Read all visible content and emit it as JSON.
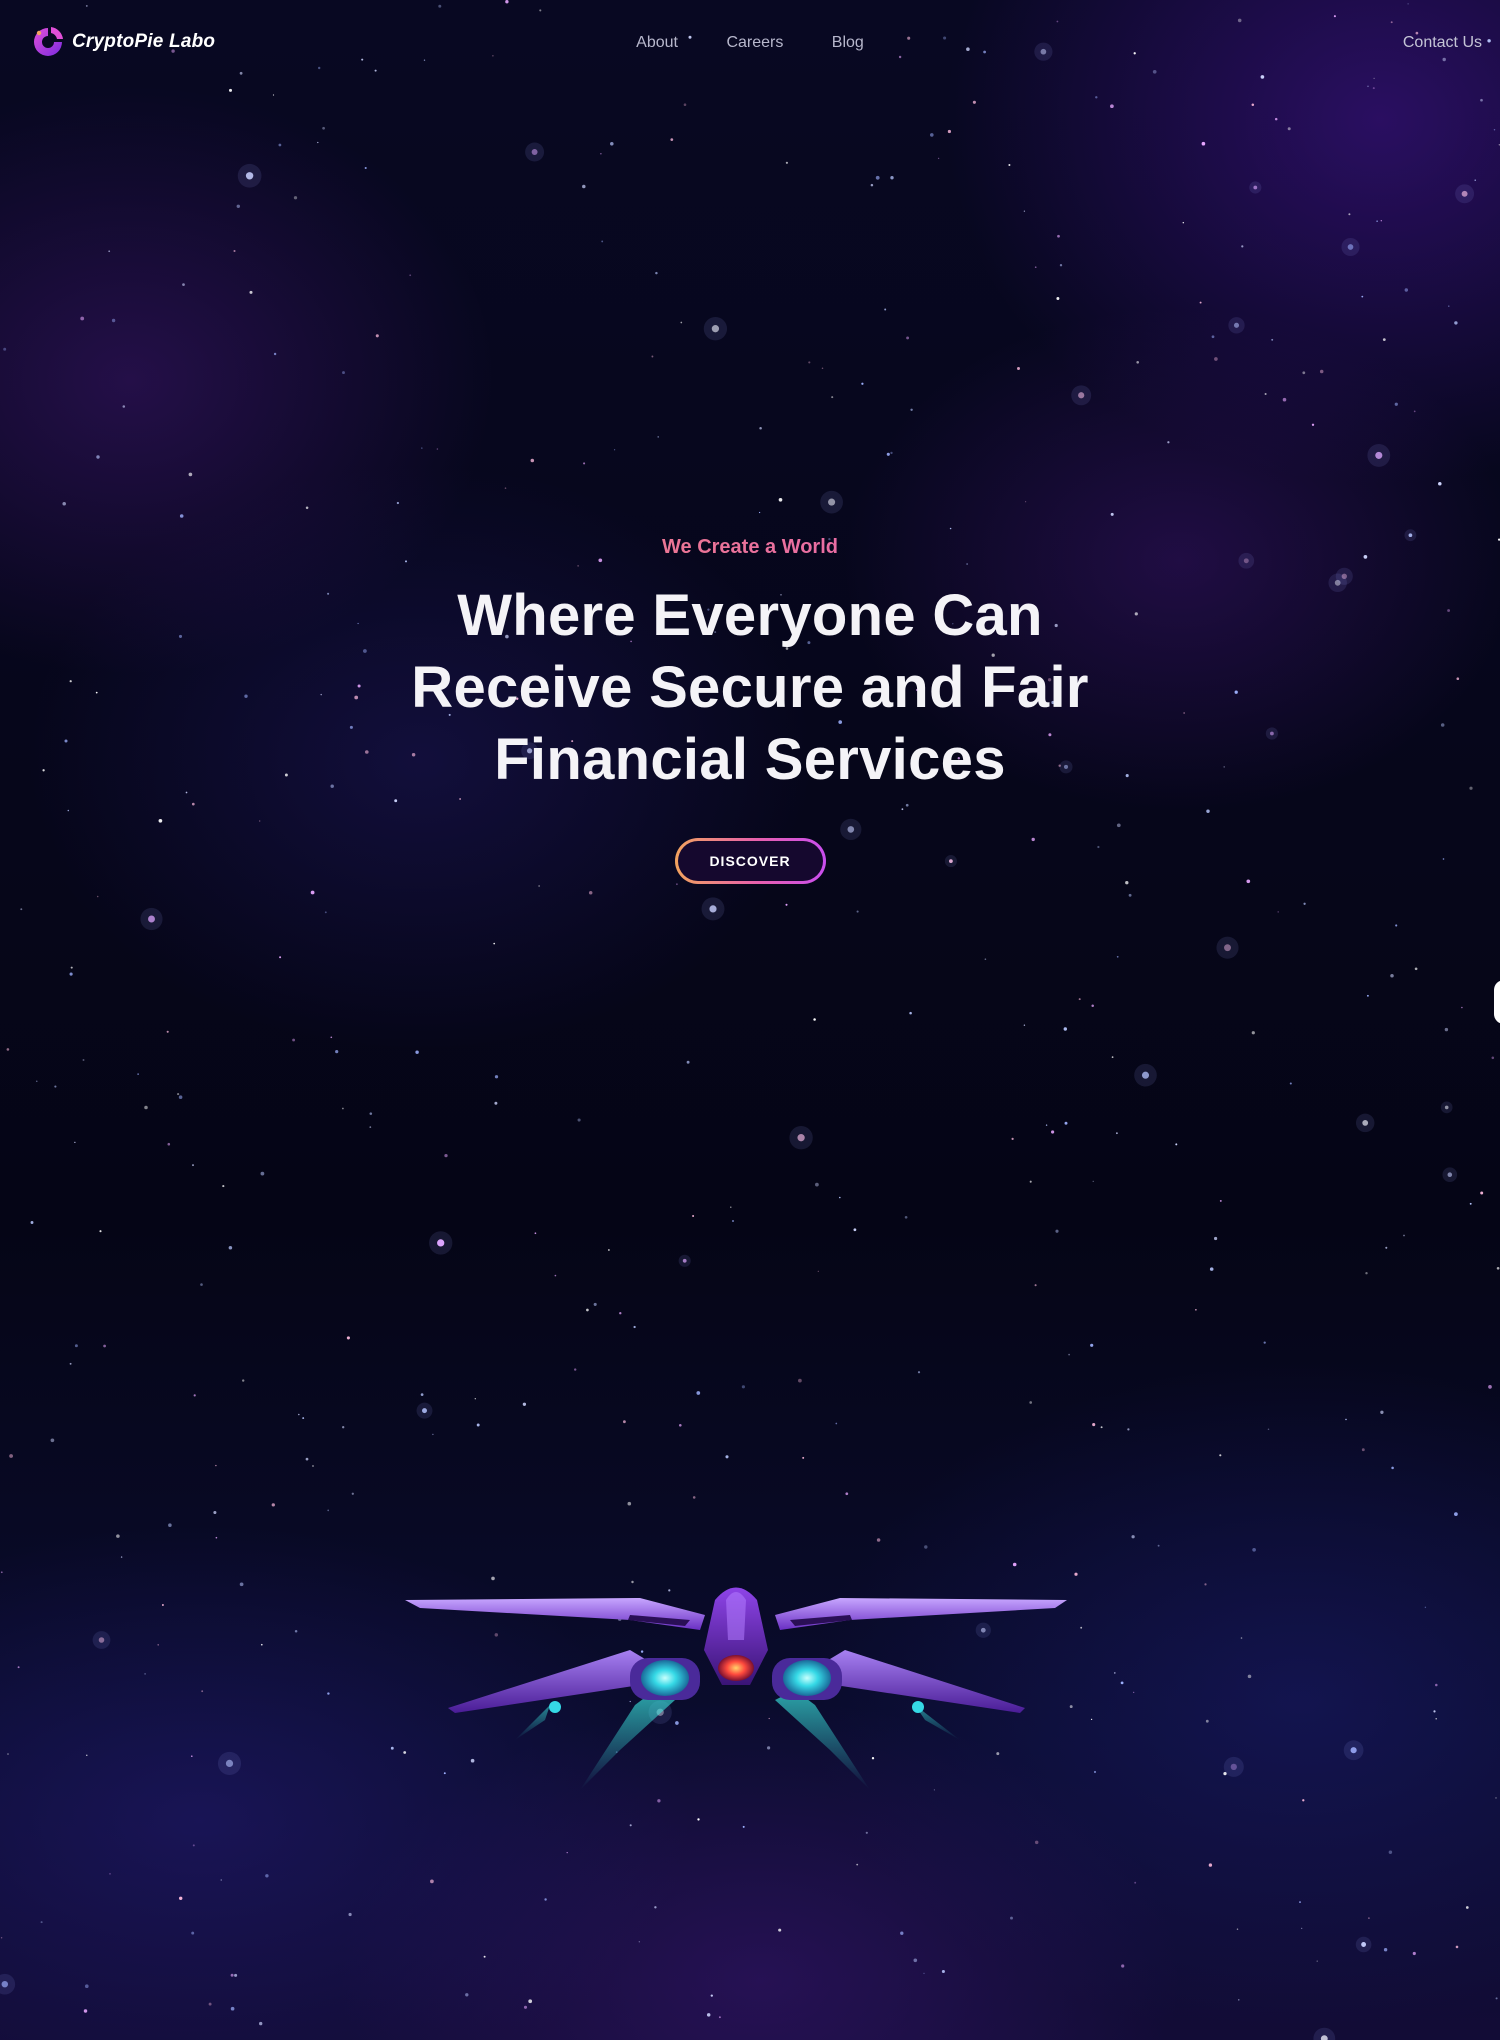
{
  "brand": {
    "name": "CryptoPie Labo",
    "logo_icon": "pie-logo-icon",
    "accent_colors": [
      "#f1975e",
      "#e96aa8",
      "#c94ef0"
    ]
  },
  "nav": {
    "links": [
      {
        "label": "About"
      },
      {
        "label": "Careers"
      },
      {
        "label": "Blog"
      }
    ],
    "contact_label": "Contact Us"
  },
  "hero": {
    "eyebrow": "We Create a World",
    "headline": "Where Everyone Can Receive Secure and Fair Financial Services",
    "cta_label": "DISCOVER"
  },
  "background": {
    "theme": "starfield-nebula",
    "illustration": "spaceship-illustration"
  }
}
